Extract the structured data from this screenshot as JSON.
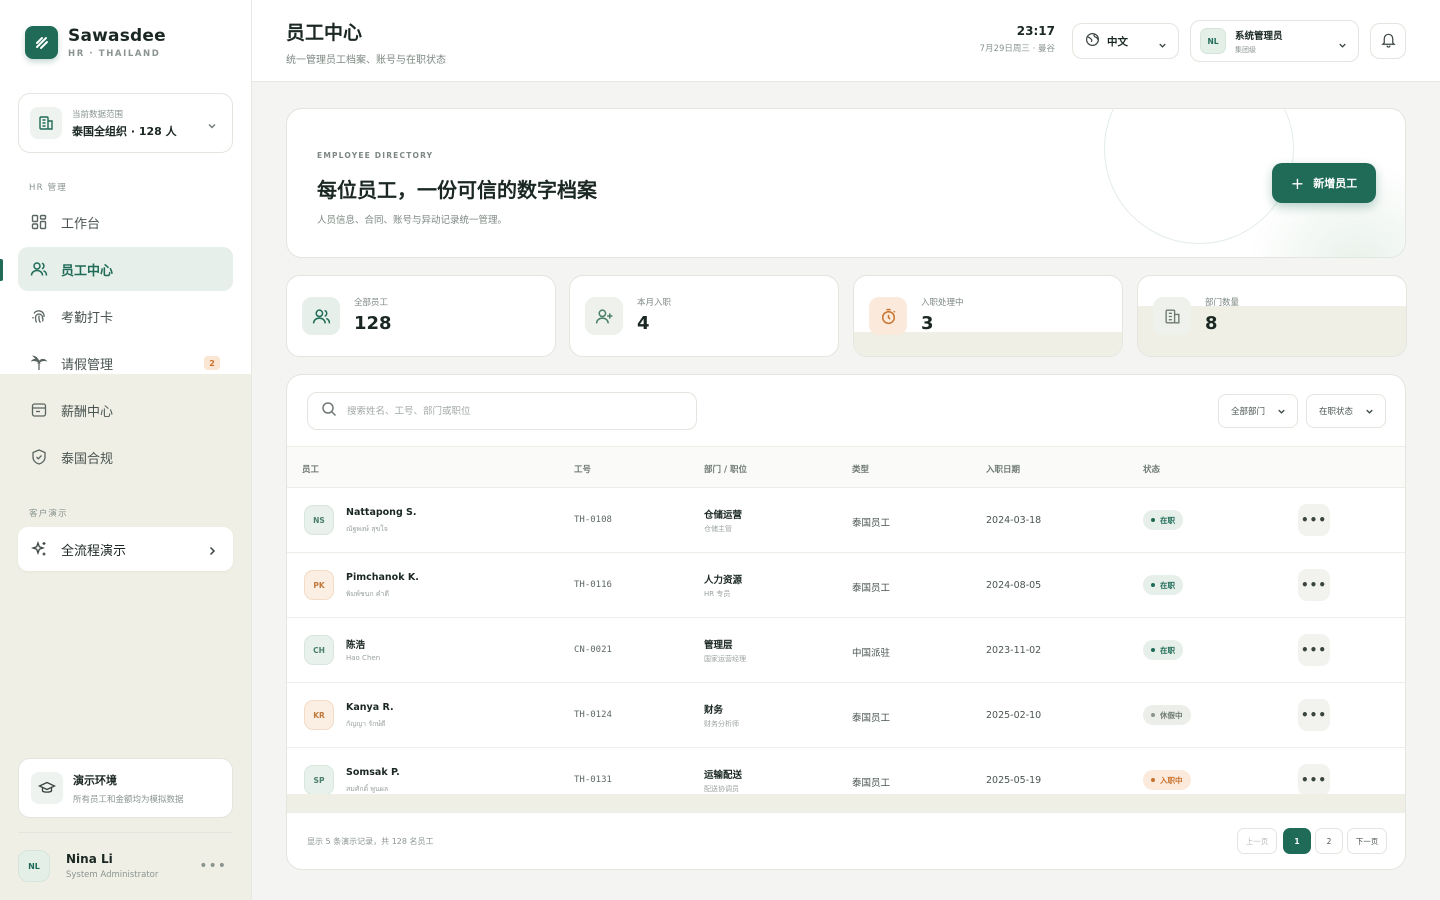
{
  "brand": {
    "name": "Sawasdee",
    "subtitle": "HR · THAILAND"
  },
  "scope": {
    "label": "当前数据范围",
    "value": "泰国全组织 · 128 人"
  },
  "sidebar": {
    "section_hr": "HR 管理",
    "items": [
      {
        "label": "工作台",
        "icon": "dashboard-icon",
        "active": false
      },
      {
        "label": "员工中心",
        "icon": "users-icon",
        "active": true
      },
      {
        "label": "考勤打卡",
        "icon": "fingerprint-icon",
        "active": false
      },
      {
        "label": "请假管理",
        "icon": "leave-icon",
        "active": false,
        "badge": "2"
      },
      {
        "label": "薪酬中心",
        "icon": "wallet-icon",
        "active": false
      },
      {
        "label": "泰国合规",
        "icon": "shield-icon",
        "active": false
      }
    ],
    "section_demo": "客户演示",
    "demo_item": {
      "label": "全流程演示",
      "icon": "sparkles-icon"
    }
  },
  "env": {
    "title": "演示环境",
    "desc": "所有员工和金额均为模拟数据"
  },
  "user": {
    "initials": "NL",
    "name": "Nina Li",
    "role": "System Administrator"
  },
  "header": {
    "title": "员工中心",
    "subtitle": "统一管理员工档案、账号与在职状态",
    "time": "23:17",
    "date": "7月29日周三 · 曼谷",
    "language": "中文",
    "account": {
      "initials": "NL",
      "name": "系统管理员",
      "level": "集团级"
    }
  },
  "hero": {
    "eyebrow": "EMPLOYEE DIRECTORY",
    "title": "每位员工，一份可信的数字档案",
    "desc": "人员信息、合同、账号与异动记录统一管理。",
    "add_button": "新增员工"
  },
  "stats": [
    {
      "label": "全部员工",
      "value": "128",
      "icon": "users-icon"
    },
    {
      "label": "本月入职",
      "value": "4",
      "icon": "user-plus-icon"
    },
    {
      "label": "入职处理中",
      "value": "3",
      "icon": "timer-icon"
    },
    {
      "label": "部门数量",
      "value": "8",
      "icon": "building-icon"
    }
  ],
  "table": {
    "search_placeholder": "搜索姓名、工号、部门或职位",
    "filters": {
      "department": "全部部门",
      "status": "在职状态"
    },
    "columns": [
      "员工",
      "工号",
      "部门 / 职位",
      "类型",
      "入职日期",
      "状态"
    ],
    "rows": [
      {
        "initials": "NS",
        "name": "Nattapong S.",
        "native": "ณัฐพงษ์ สุขใจ",
        "id": "TH-0108",
        "dept": "仓储运营",
        "role": "仓储主管",
        "type": "泰国员工",
        "date": "2024-03-18",
        "status": "在职"
      },
      {
        "initials": "PK",
        "name": "Pimchanok K.",
        "native": "พิมพ์ชนก คำดี",
        "id": "TH-0116",
        "dept": "人力资源",
        "role": "HR 专员",
        "type": "泰国员工",
        "date": "2024-08-05",
        "status": "在职"
      },
      {
        "initials": "CH",
        "name": "陈浩",
        "native": "Hao Chen",
        "id": "CN-0021",
        "dept": "管理层",
        "role": "国家运营经理",
        "type": "中国派驻",
        "date": "2023-11-02",
        "status": "在职"
      },
      {
        "initials": "KR",
        "name": "Kanya R.",
        "native": "กัญญา รักษ์ดี",
        "id": "TH-0124",
        "dept": "财务",
        "role": "财务分析师",
        "type": "泰国员工",
        "date": "2025-02-10",
        "status": "休假中"
      },
      {
        "initials": "SP",
        "name": "Somsak P.",
        "native": "สมศักดิ์ พูนผล",
        "id": "TH-0131",
        "dept": "运输配送",
        "role": "配送协调员",
        "type": "泰国员工",
        "date": "2025-05-19",
        "status": "入职中"
      }
    ],
    "footer": "显示 5 条演示记录，共 128 名员工",
    "pagination": {
      "prev": "上一页",
      "pages": [
        "1",
        "2"
      ],
      "next": "下一页"
    }
  },
  "colors": {
    "accent": "#1f6b57",
    "warm": "#c9722e",
    "background": "#f4f5f2"
  }
}
